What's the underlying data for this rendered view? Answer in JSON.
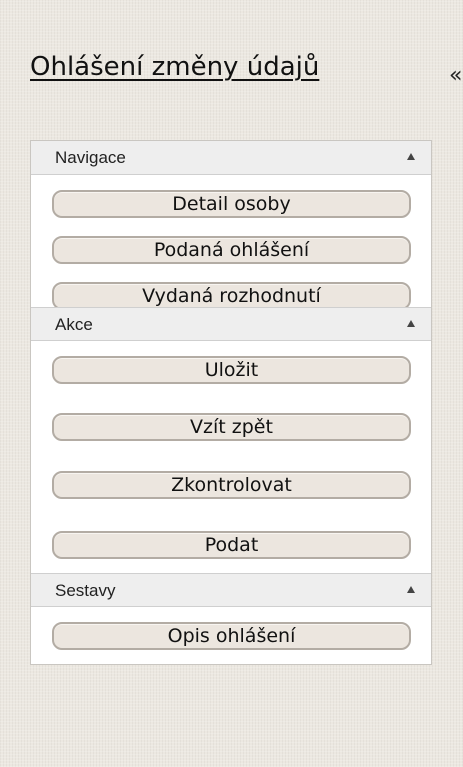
{
  "page": {
    "title": "Ohlášení změny údajů",
    "title_overflow": "«"
  },
  "sidebar": {
    "sections": [
      {
        "title": "Navigace",
        "collapse_icon": "triangle-up-icon",
        "items": [
          "Detail osoby",
          "Podaná ohlášení",
          "Vydaná rozhodnutí"
        ]
      },
      {
        "title": "Akce",
        "collapse_icon": "triangle-up-icon",
        "items": [
          "Uložit",
          "Vzít zpět",
          "Zkontrolovat",
          "Podat"
        ]
      },
      {
        "title": "Sestavy",
        "collapse_icon": "triangle-up-icon",
        "items": [
          "Opis ohlášení"
        ]
      }
    ]
  },
  "colors": {
    "background": "#ece8e1",
    "panel": "#ffffff",
    "section_header": "#eeeeee",
    "button_fill": "#ece6df",
    "button_border": "#b3aca4"
  }
}
